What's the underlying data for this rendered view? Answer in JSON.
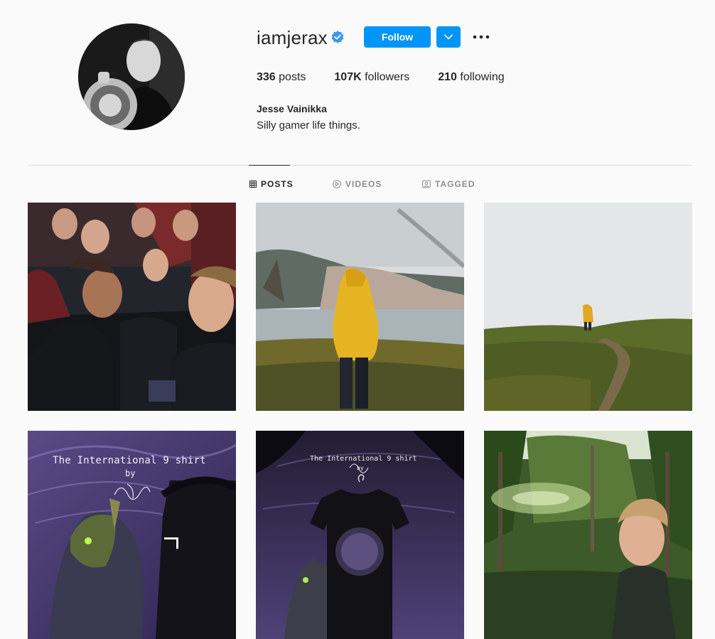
{
  "profile": {
    "username": "iamjerax",
    "follow_label": "Follow",
    "stats": {
      "posts_count": "336",
      "posts_label": "posts",
      "followers_count": "107K",
      "followers_label": "followers",
      "following_count": "210",
      "following_label": "following"
    },
    "full_name": "Jesse Vainikka",
    "bio": "Silly gamer life things."
  },
  "tabs": [
    {
      "label": "POSTS",
      "icon": "grid-icon",
      "active": true
    },
    {
      "label": "VIDEOS",
      "icon": "play-icon",
      "active": false
    },
    {
      "label": "TAGGED",
      "icon": "tag-icon",
      "active": false
    }
  ],
  "posts": [
    {
      "subject": "team-selfie"
    },
    {
      "subject": "yellow-raincoat-shore"
    },
    {
      "subject": "yellow-raincoat-hill"
    },
    {
      "subject": "ti9-shirt-art",
      "title": "The International 9 shirt",
      "by": "by"
    },
    {
      "subject": "ti9-shirt-photo",
      "title": "The International 9 shirt",
      "by": "by"
    },
    {
      "subject": "forest-selfie"
    }
  ],
  "colors": {
    "accent": "#0095f6",
    "verified": "#3897f0",
    "background": "#fafafa",
    "text": "#262626",
    "muted": "#8e8e8e"
  }
}
